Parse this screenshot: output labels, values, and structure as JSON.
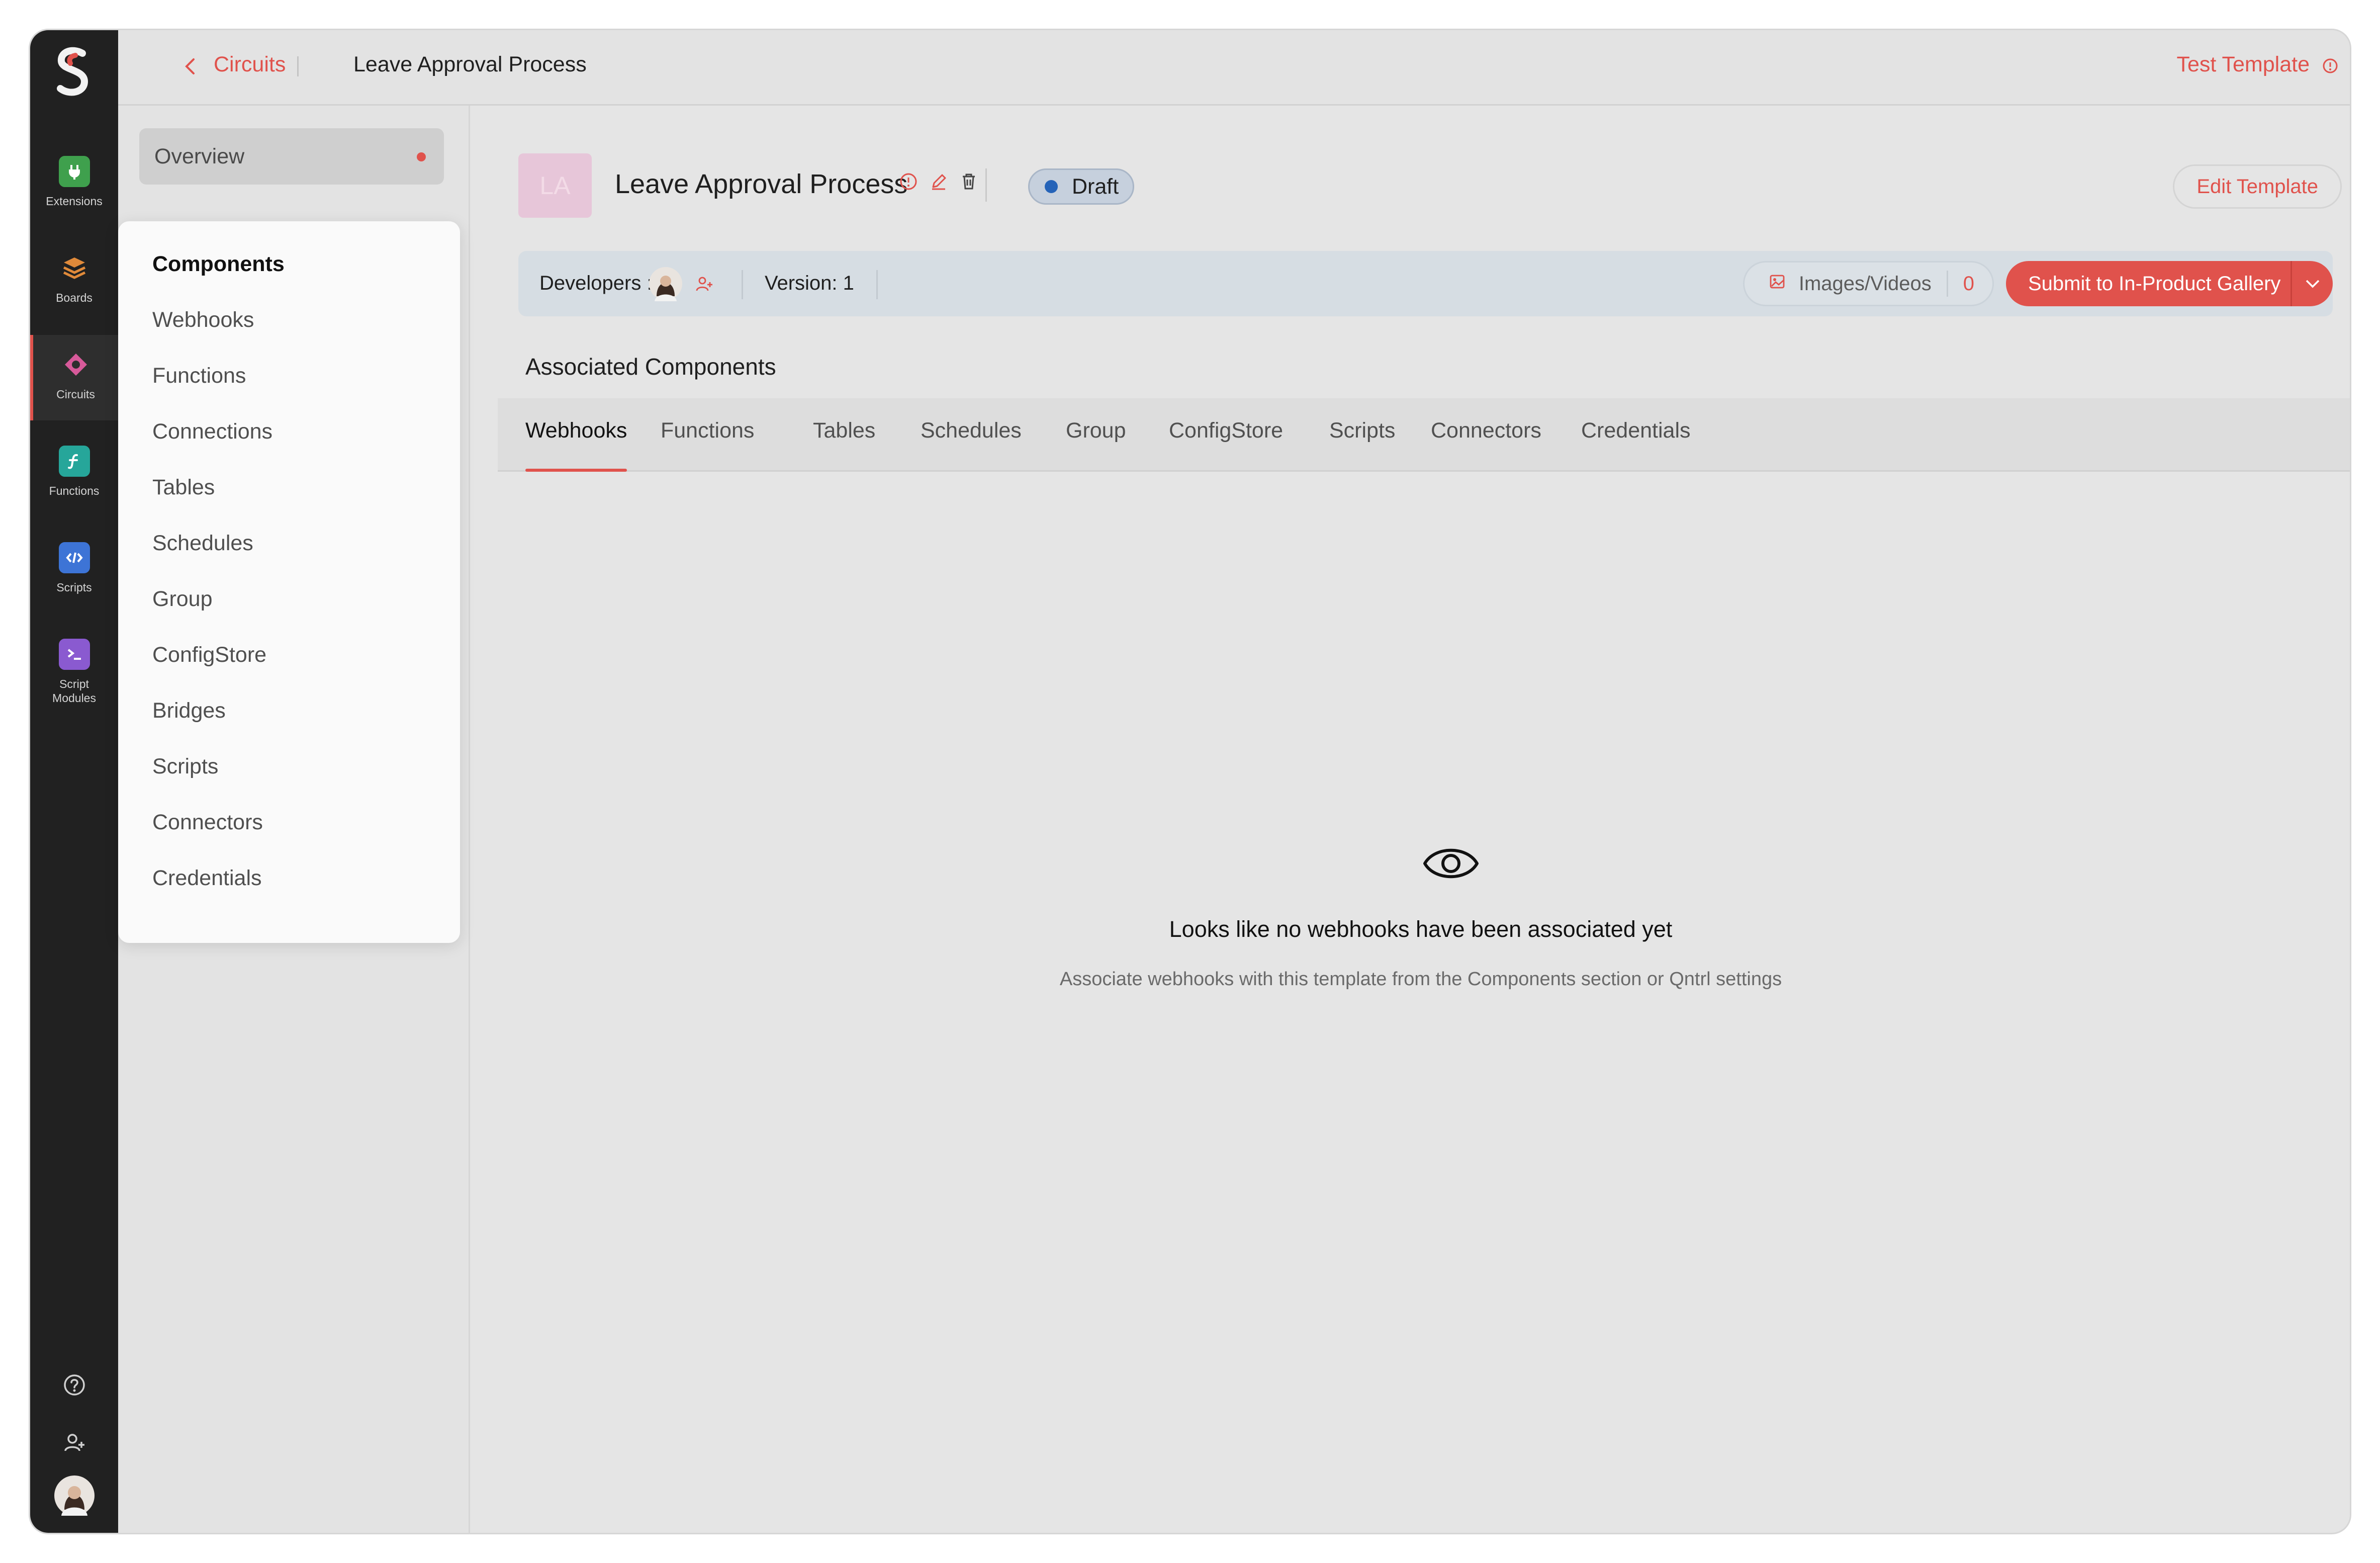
{
  "rail": {
    "items": [
      {
        "label": "Extensions",
        "icon": "plug-icon",
        "color": "#3fa04d"
      },
      {
        "label": "Boards",
        "icon": "layers-icon",
        "color": "#e08a3a"
      },
      {
        "label": "Circuits",
        "icon": "circuit-icon",
        "color": "#d75a9a"
      },
      {
        "label": "Functions",
        "icon": "function-icon",
        "color": "#26a69a"
      },
      {
        "label": "Scripts",
        "icon": "code-icon",
        "color": "#3d74d6"
      },
      {
        "label": "Script\nModules",
        "icon": "terminal-icon",
        "color": "#8a5ad0"
      }
    ],
    "active": "Circuits"
  },
  "topbar": {
    "back_link": "Circuits",
    "title": "Leave Approval Process",
    "test_template": "Test Template"
  },
  "nav": {
    "overview": "Overview",
    "components_header": "Components",
    "components": [
      "Webhooks",
      "Functions",
      "Connections",
      "Tables",
      "Schedules",
      "Group",
      "ConfigStore",
      "Bridges",
      "Scripts",
      "Connectors",
      "Credentials"
    ]
  },
  "template": {
    "initials": "LA",
    "name": "Leave Approval Process",
    "status": "Draft",
    "edit_label": "Edit Template"
  },
  "infobar": {
    "developers_label": "Developers :",
    "version_label": "Version: 1",
    "images_label": "Images/Videos",
    "images_count": "0",
    "submit_label": "Submit to In-Product Gallery"
  },
  "associated": {
    "title": "Associated Components",
    "tabs": [
      "Webhooks",
      "Functions",
      "Tables",
      "Schedules",
      "Group",
      "ConfigStore",
      "Scripts",
      "Connectors",
      "Credentials"
    ],
    "active_tab": "Webhooks",
    "empty_title": "Looks like no webhooks have been associated yet",
    "empty_subtitle": "Associate webhooks with this template from the Components section or Qntrl settings"
  },
  "colors": {
    "accent": "#e0524c",
    "rail_bg": "#212121",
    "draft_dot": "#2563b8"
  }
}
